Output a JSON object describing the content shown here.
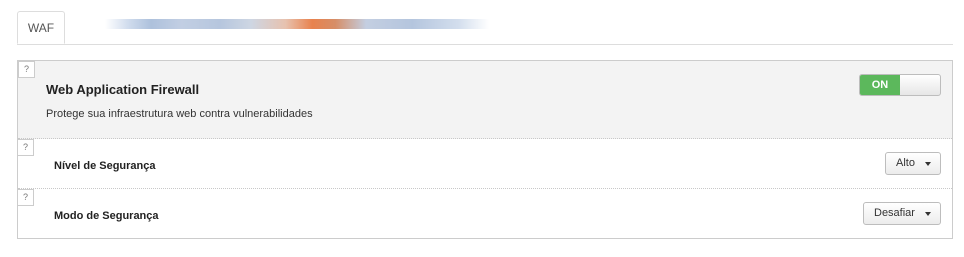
{
  "tabs": [
    {
      "label": "WAF",
      "active": true
    }
  ],
  "waf": {
    "help": "?",
    "title": "Web Application Firewall",
    "description": "Protege sua infraestrutura web contra vulnerabilidades",
    "toggle_label": "ON",
    "toggle_color": "#5cb85c"
  },
  "security_level": {
    "help": "?",
    "label": "Nível de Segurança",
    "selected": "Alto"
  },
  "security_mode": {
    "help": "?",
    "label": "Modo de Segurança",
    "selected": "Desafiar"
  }
}
